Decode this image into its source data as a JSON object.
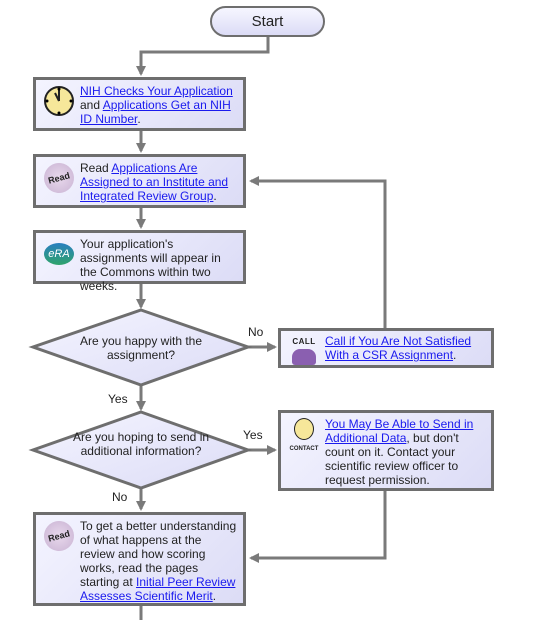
{
  "start": "Start",
  "step1": {
    "link1": "NIH Checks Your Application",
    "mid": "and ",
    "link2": "Applications Get an NIH ID Number",
    "end": ".",
    "icon": "clock-icon"
  },
  "step2": {
    "pre": "Read ",
    "link": "Applications Are Assigned to an Institute and Integrated Review Group",
    "end": ".",
    "icon": "read-icon",
    "icon_text": "Read"
  },
  "step3": {
    "text": "Your application's assignments will appear in the Commons within two weeks.",
    "icon": "era-logo",
    "icon_text": "eRA"
  },
  "decision1": {
    "text": "Are you happy with the assignment?",
    "no": "No",
    "yes": "Yes"
  },
  "call_box": {
    "link": "Call if You Are Not Satisfied With a CSR Assignment",
    "end": ".",
    "icon": "phone-icon",
    "icon_text": "CALL"
  },
  "decision2": {
    "text": "Are you hoping to send in additional information?",
    "yes": "Yes",
    "no": "No"
  },
  "contact_box": {
    "link": "You May Be Able to Send in Additional Data",
    "rest": ", but don't count on it. Contact your scientific review officer to request permission.",
    "icon": "contact-face-icon",
    "icon_text": "CONTACT"
  },
  "step4": {
    "pre": "To get a better understanding of what happens at the review and how scoring works, read the pages starting at ",
    "link": "Initial Peer Review Assesses Scientific Merit",
    "end": ".",
    "icon": "read-icon",
    "icon_text": "Read"
  },
  "colors": {
    "box_border": "#6e6e6e",
    "box_fill": "#e4e4fa",
    "link": "#1a1aee",
    "connector": "#7a7a7a"
  }
}
